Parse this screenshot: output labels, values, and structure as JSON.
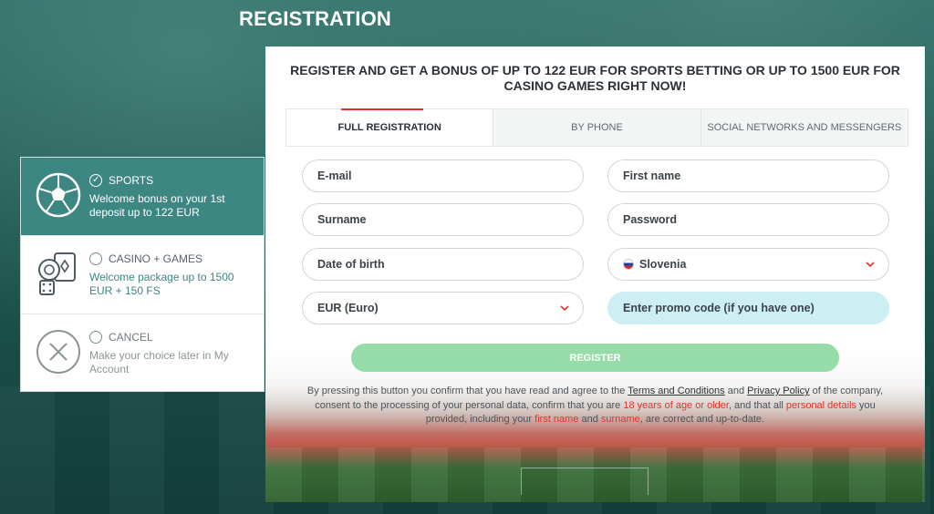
{
  "page": {
    "title": "REGISTRATION"
  },
  "bonus_options": [
    {
      "title": "SPORTS",
      "description": "Welcome bonus on your 1st deposit up to 122 EUR",
      "icon": "soccer-ball-icon",
      "selected": true
    },
    {
      "title": "CASINO + GAMES",
      "description": "Welcome package up to 1500 EUR + 150 FS",
      "icon": "casino-chips-dice-icon",
      "selected": false
    },
    {
      "title": "CANCEL",
      "description": "Make your choice later in My Account",
      "icon": "cancel-x-icon",
      "selected": false
    }
  ],
  "form": {
    "headline": "REGISTER AND GET A BONUS OF UP TO 122 EUR FOR SPORTS BETTING OR UP TO 1500 EUR FOR CASINO GAMES RIGHT NOW!",
    "tabs": [
      {
        "label": "FULL REGISTRATION",
        "active": true
      },
      {
        "label": "BY PHONE",
        "active": false
      },
      {
        "label": "SOCIAL NETWORKS AND MESSENGERS",
        "active": false
      }
    ],
    "fields": {
      "email": "E-mail",
      "first_name": "First name",
      "surname": "Surname",
      "password": "Password",
      "date_of_birth": "Date of birth",
      "country": "Slovenia",
      "currency": "EUR (Euro)",
      "promo": "Enter promo code (if you have one)"
    },
    "register_label": "REGISTER",
    "disclaimer": {
      "p1": "By pressing this button you confirm that you have read and agree to the ",
      "terms": "Terms and Conditions",
      "p2": " and ",
      "privacy": "Privacy Policy",
      "p3": " of the company, consent to the processing of your personal data, confirm that you are ",
      "age": "18 years of age or older",
      "p4": ", and that all ",
      "personal_details": "personal details",
      "p5": " you provided, including your ",
      "first_name": "first name",
      "p6": " and ",
      "surname": "surname",
      "p7": ", are correct and up-to-date."
    }
  },
  "colors": {
    "accent_teal": "#3d8783",
    "accent_red": "#e0332a",
    "register_green": "#95dca8",
    "promo_bg": "#cdeff4"
  }
}
